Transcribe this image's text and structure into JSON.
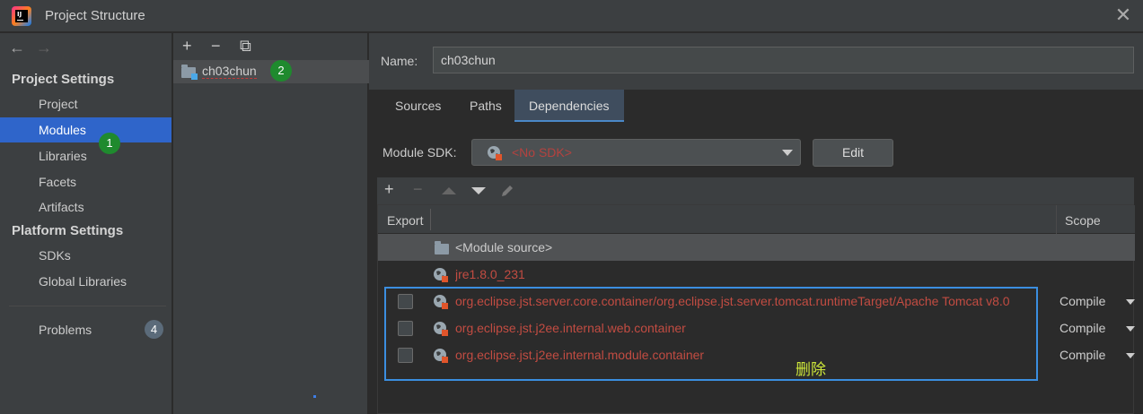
{
  "window": {
    "title": "Project Structure",
    "close": "✕"
  },
  "nav": {
    "back": "←",
    "forward": "→",
    "project_settings_header": "Project Settings",
    "platform_settings_header": "Platform Settings",
    "items": {
      "project": "Project",
      "modules": "Modules",
      "libraries": "Libraries",
      "facets": "Facets",
      "artifacts": "Artifacts",
      "sdks": "SDKs",
      "global_libraries": "Global Libraries",
      "problems": "Problems"
    },
    "problems_count": "4",
    "step_badge": "1",
    "selected": "Modules"
  },
  "modules_pane": {
    "add": "+",
    "remove": "−",
    "copy": "⧉",
    "module_name": "ch03chun",
    "step_badge": "2"
  },
  "main": {
    "name_label": "Name:",
    "name_value": "ch03chun",
    "tabs": [
      "Sources",
      "Paths",
      "Dependencies"
    ],
    "selected_tab": "Dependencies",
    "module_sdk_label": "Module SDK:",
    "module_sdk_value": "<No SDK>",
    "edit_button": "Edit",
    "dep_tools": {
      "add": "+",
      "remove": "−"
    },
    "table": {
      "col_export": "Export",
      "col_scope": "Scope",
      "rows": [
        {
          "name": "<Module source>",
          "scope": ""
        },
        {
          "name": "jre1.8.0_231",
          "scope": ""
        },
        {
          "name": "org.eclipse.jst.server.core.container/org.eclipse.jst.server.tomcat.runtimeTarget/Apache Tomcat v8.0",
          "scope": "Compile"
        },
        {
          "name": "org.eclipse.jst.j2ee.internal.web.container",
          "scope": "Compile"
        },
        {
          "name": "org.eclipse.jst.j2ee.internal.module.container",
          "scope": "Compile"
        }
      ]
    }
  },
  "annotation": "删除",
  "colors": {
    "accent": "#2f65ca",
    "error_text": "#c24c42",
    "highlight_box": "#3b8ee0",
    "annotation": "#cde63a",
    "badge_green": "#1f8a2e"
  }
}
